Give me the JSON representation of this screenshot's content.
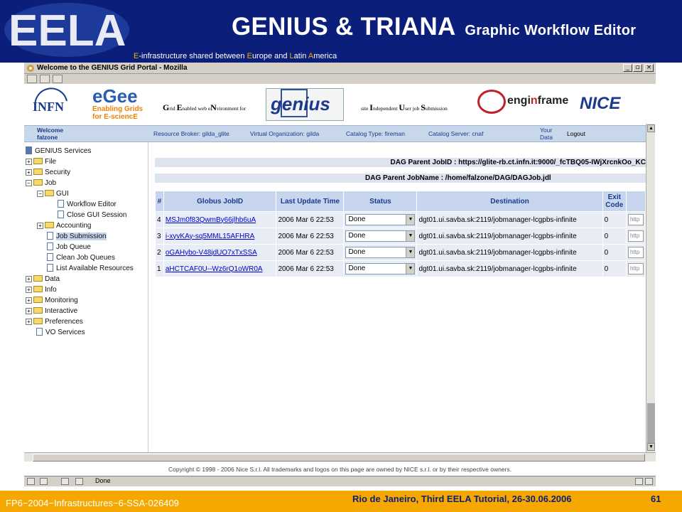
{
  "slide": {
    "title": "GENIUS & TRIANA",
    "subtitle": "Graphic Workflow Editor",
    "tagline": {
      "p1": "E",
      "p2": "-infrastructure shared between ",
      "p3": "E",
      "p4": "urope and ",
      "p5": "L",
      "p6": "atin ",
      "p7": "A",
      "p8": "merica"
    },
    "logo_text": "EELA"
  },
  "window": {
    "title": "Welcome to the GENIUS Grid Portal - Mozilla",
    "controls": {
      "minimize": "_",
      "restore": "▫",
      "close": "×"
    }
  },
  "logos": {
    "infn": "INFN",
    "egee": "eGee",
    "egee_sub": "Enabling Grids for E-sciencE",
    "genius_acronym": {
      "g": "G",
      "g2": "rid ",
      "e": "E",
      "e2": "nabled web e",
      "n": "N",
      "n2": "vironment for"
    },
    "genius": "genius",
    "site_indep": {
      "s": "site ",
      "i": "I",
      "i2": "ndependent ",
      "u": "U",
      "u2": "ser job ",
      "s3": "S",
      "s4": "ubmission"
    },
    "enginframe": "engi frame",
    "enginframe_mid": "n",
    "nice": "NICE"
  },
  "navbar": {
    "welcome": "Welcome",
    "user": "falzone",
    "broker": "Resource Broker: gilda_glite",
    "vo": "Virtual Organization: gilda",
    "catalog_type": "Catalog Type: fireman",
    "catalog_server": "Catalog Server: cnaf",
    "your": "Your",
    "data": "Data",
    "logout": "Logout"
  },
  "sidebar": {
    "root": "GENIUS Services",
    "file": "File",
    "security": "Security",
    "job": "Job",
    "gui": "GUI",
    "workflow_editor": "Workflow Editor",
    "close_gui": "Close GUI Session",
    "accounting": "Accounting",
    "job_submission": "Job Submission",
    "job_queue": "Job Queue",
    "clean_queues": "Clean Job Queues",
    "list_resources": "List Available Resources",
    "data": "Data",
    "info": "Info",
    "monitoring": "Monitoring",
    "interactive": "Interactive",
    "preferences": "Preferences",
    "vo_services": "VO Services"
  },
  "dag": {
    "parent_jobid": "DAG Parent JobID : https://glite-rb.ct.infn.it:9000/_fcTBQ05-IWjXrcnkOo_KC",
    "parent_jobname": "DAG Parent JobName : /home/falzone/DAG/DAGJob.jdl"
  },
  "table": {
    "headers": {
      "num": "#",
      "jobid": "Globus JobID",
      "update": "Last Update Time",
      "status": "Status",
      "dest": "Destination",
      "exit": "Exit Code"
    },
    "rows": [
      {
        "num": "4",
        "jobid": "MSJm0f83QwmBy66jlhb6uA",
        "time": "2006 Mar 6 22:53",
        "status": "Done",
        "dest": "dgt01.ui.savba.sk:2119/jobmanager-lcgpbs-infinite",
        "exit": "0",
        "extra": "http"
      },
      {
        "num": "3",
        "jobid": "i-xyvKAy-sq5MML15AFHRA",
        "time": "2006 Mar 6 22:53",
        "status": "Done",
        "dest": "dgt01.ui.savba.sk:2119/jobmanager-lcgpbs-infinite",
        "exit": "0",
        "extra": "http"
      },
      {
        "num": "2",
        "jobid": "oGAHybo-V48jdUO7xTxSSA",
        "time": "2006 Mar 6 22:53",
        "status": "Done",
        "dest": "dgt01.ui.savba.sk:2119/jobmanager-lcgpbs-infinite",
        "exit": "0",
        "extra": "http"
      },
      {
        "num": "1",
        "jobid": "aHCTCAF0U--Wz6rQ1oWR0A",
        "time": "2006 Mar 6 22:53",
        "status": "Done",
        "dest": "dgt01.ui.savba.sk:2119/jobmanager-lcgpbs-infinite",
        "exit": "0",
        "extra": "http"
      }
    ]
  },
  "copyright": "Copyright © 1998 - 2006 Nice S.r.l. All trademarks and logos on this page are owned by NICE s.r.l. or by their respective owners.",
  "status": "Done",
  "footer": {
    "left": "FP6−2004−Infrastructures−6-SSA-026409",
    "center": "Rio de Janeiro, Third EELA Tutorial, 26-30.06.2006",
    "page": "61"
  },
  "colors": {
    "banner": "#0b1f7a",
    "footer": "#f6a800",
    "header_bg": "#c7d6ee",
    "link": "#0000cc"
  }
}
